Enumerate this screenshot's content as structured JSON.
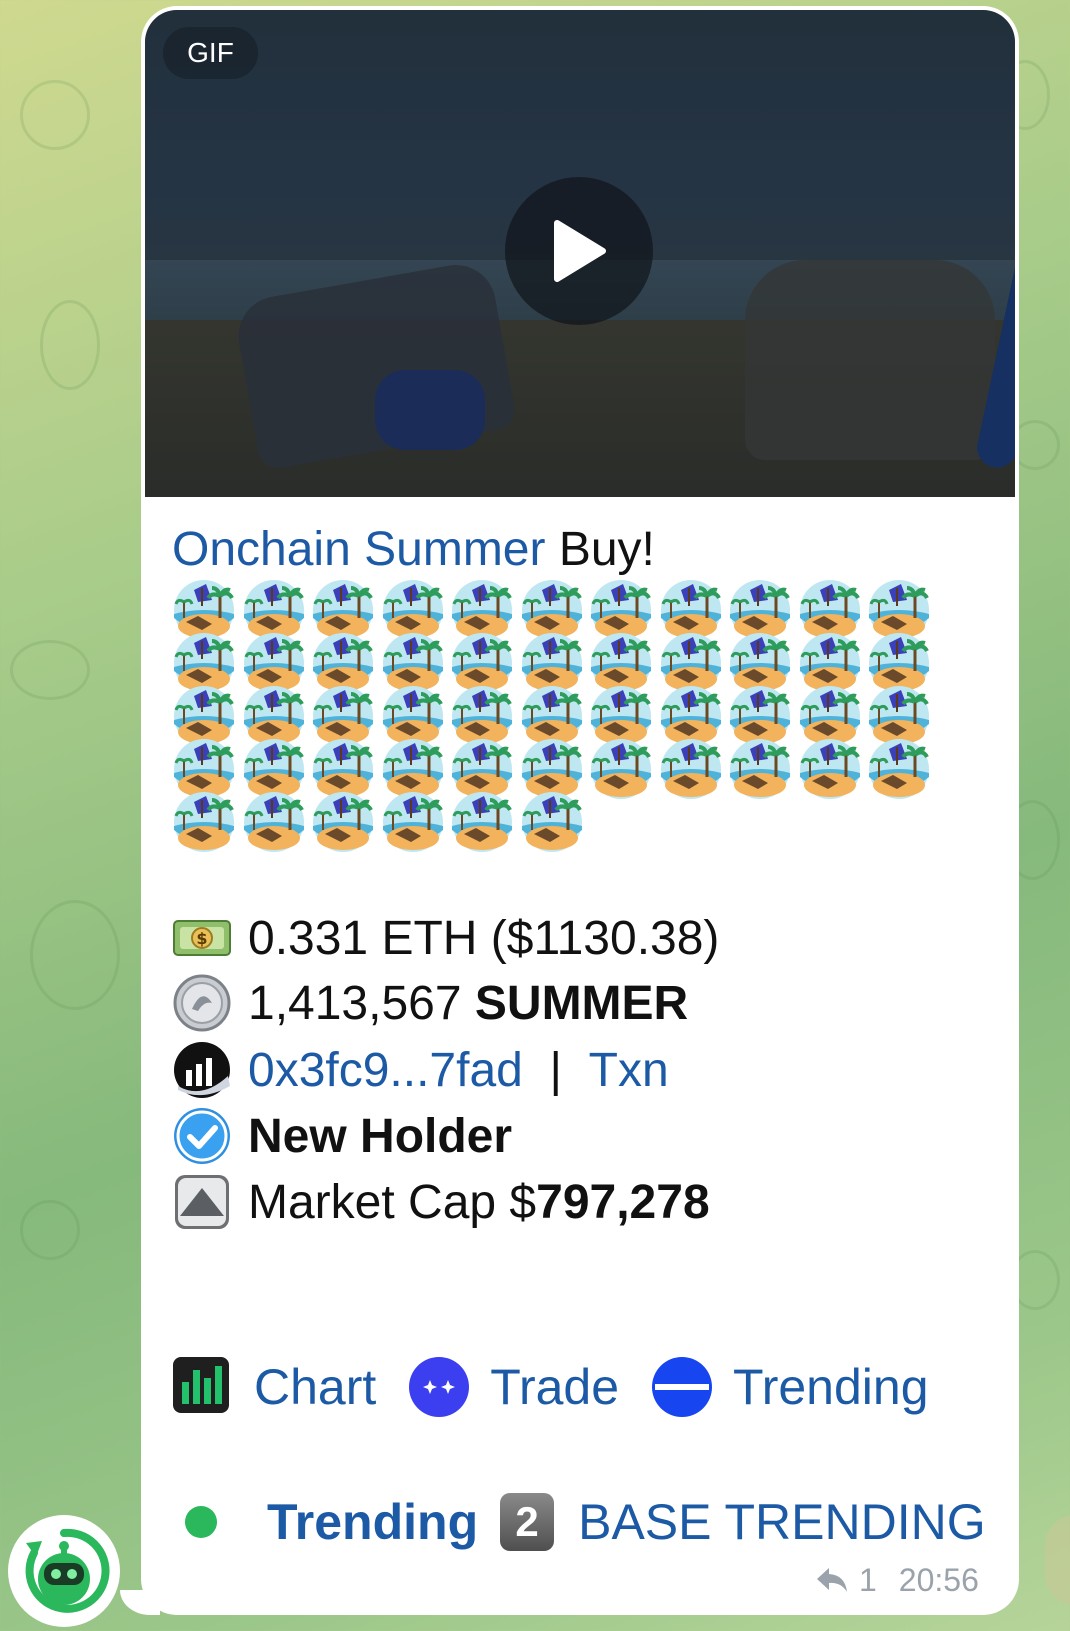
{
  "media": {
    "badge": "GIF",
    "play_icon": "play-icon"
  },
  "message": {
    "title_link": "Onchain Summer",
    "title_rest": " Buy!",
    "emoji_name": "desert-island-emoji",
    "emoji_count": 50,
    "details": {
      "eth_amount": "0.331 ETH ($1130.38)",
      "token_amount": "1,413,567",
      "token_symbol": "SUMMER",
      "wallet": "0x3fc9...7fad",
      "separator": "|",
      "txn": "Txn",
      "new_holder": "New Holder",
      "market_cap_label": "Market Cap $",
      "market_cap_value": "797,278"
    },
    "buttons": {
      "chart": "Chart",
      "trade": "Trade",
      "trending": "Trending"
    },
    "trending": {
      "label": "Trending",
      "rank": "2",
      "channel": "BASE TRENDING"
    },
    "meta": {
      "reply_count": "1",
      "time": "20:56"
    }
  },
  "colors": {
    "link": "#1c5aa6",
    "trending_dot": "#2bb85c",
    "bot_green": "#2bb85c"
  }
}
